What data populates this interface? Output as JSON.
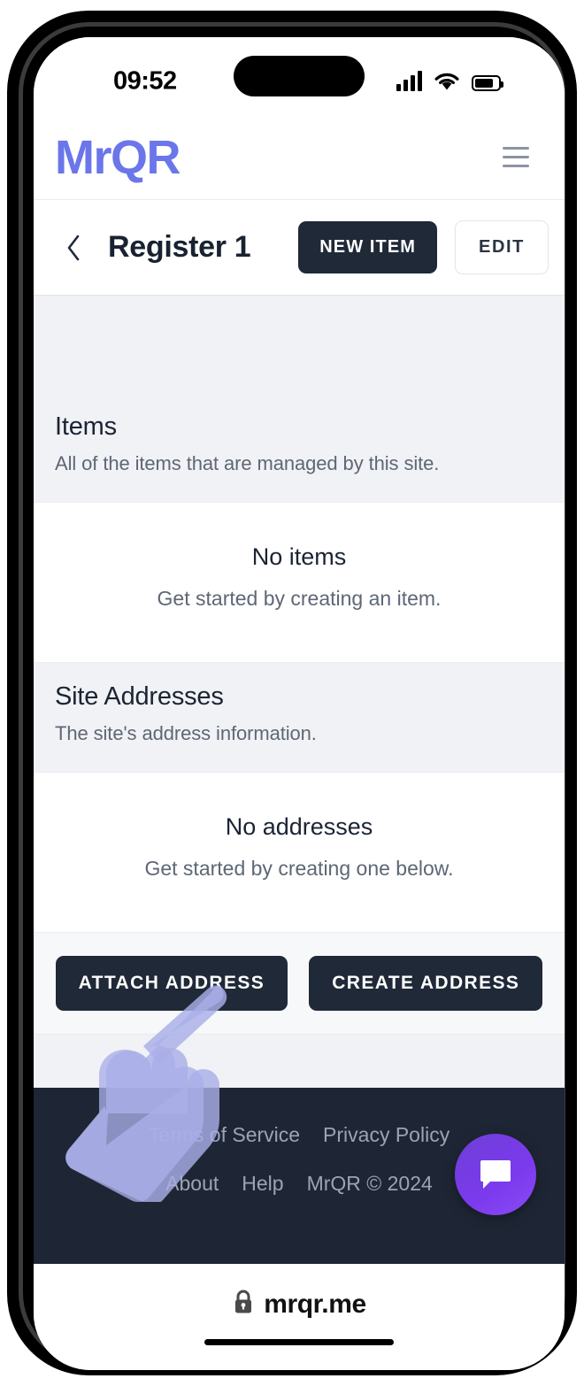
{
  "status_bar": {
    "time": "09:52",
    "icons": [
      "cellular-signal-icon",
      "wifi-icon",
      "battery-icon"
    ]
  },
  "site_header": {
    "brand": "MrQR",
    "menu_icon": "hamburger-menu-icon"
  },
  "page_header": {
    "back_icon": "chevron-left-icon",
    "title": "Register 1",
    "primary_button": "NEW ITEM",
    "secondary_button": "EDIT"
  },
  "sections": [
    {
      "heading": "Items",
      "description": "All of the items that are managed by this site.",
      "empty_title": "No items",
      "empty_subtitle": "Get started by creating an item."
    },
    {
      "heading": "Site Addresses",
      "description": "The site's address information.",
      "empty_title": "No addresses",
      "empty_subtitle": "Get started by creating one below."
    }
  ],
  "address_actions": {
    "attach_label": "ATTACH ADDRESS",
    "create_label": "CREATE ADDRESS"
  },
  "footer": {
    "links_row1": [
      "Terms of Service",
      "Privacy Policy"
    ],
    "links_row2": [
      "About",
      "Help"
    ],
    "copyright": "MrQR © 2024",
    "chat_icon": "chat-bubble-icon"
  },
  "browser_bar": {
    "lock_icon": "lock-icon",
    "url": "mrqr.me"
  },
  "colors": {
    "brand": "#6a76ea",
    "dark_button": "#1f2937",
    "footer_bg": "#1e2635",
    "chat_fab": "#7c3aed",
    "page_bg": "#f1f2f5",
    "cursor": "#a9aee8"
  }
}
